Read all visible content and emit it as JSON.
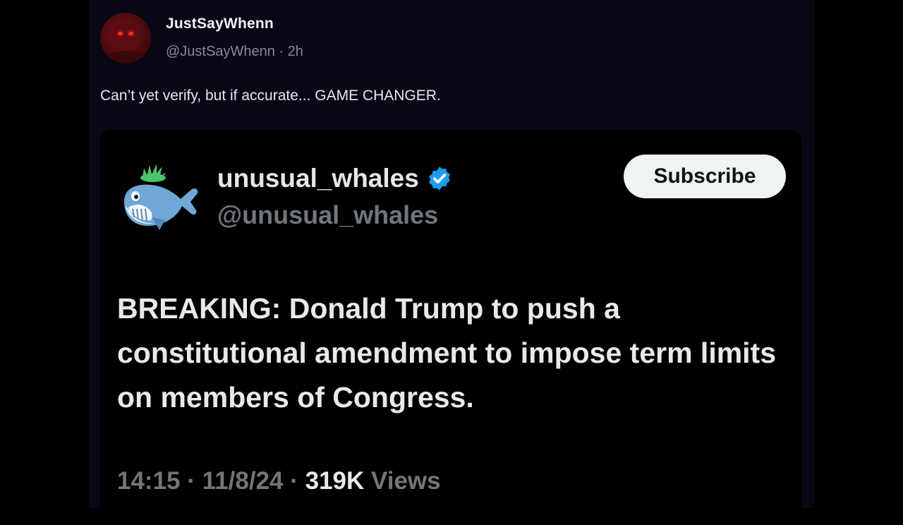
{
  "post": {
    "display_name": "JustSayWhenn",
    "handle": "@JustSayWhenn",
    "separator": "·",
    "time": "2h",
    "text": "Can’t yet verify, but if accurate... GAME CHANGER."
  },
  "embed": {
    "display_name": "unusual_whales",
    "handle": "@unusual_whales",
    "subscribe_label": "Subscribe",
    "body": "BREAKING: Donald Trump to push a constitutional amendment to impose term limits on members of Congress.",
    "time": "14:15",
    "date": "11/8/24",
    "views_count": "319K",
    "views_label": "Views",
    "separator": "·"
  },
  "icons": {
    "avatar": "user-avatar",
    "embed_avatar": "whale-icon",
    "verified": "verified-badge-icon"
  },
  "colors": {
    "background": "#000000",
    "column": "#080714",
    "verified": "#1d9bf0",
    "muted": "#71767b",
    "subscribe_bg": "#eff3f4"
  }
}
